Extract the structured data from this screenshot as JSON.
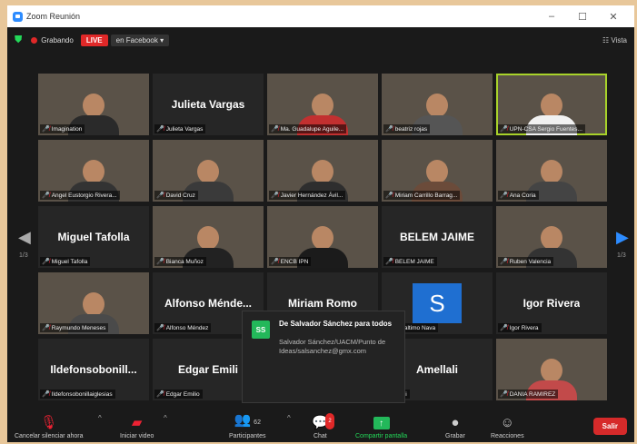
{
  "window": {
    "title": "Zoom Reunión",
    "minimize": "–",
    "maximize": "☐",
    "close": "✕"
  },
  "topbar": {
    "recording": "Grabando",
    "live": "LIVE",
    "stream_target": "en Facebook ▾",
    "view": "☷ Vista"
  },
  "pager": {
    "left_page": "1/3",
    "right_page": "1/3"
  },
  "tiles": [
    {
      "big": "",
      "tag": "Imagination",
      "video": true,
      "shirt": "#2a2a2a"
    },
    {
      "big": "Julieta Vargas",
      "tag": "Julieta Vargas",
      "video": false
    },
    {
      "big": "",
      "tag": "Ma. Guadalupe Aguile...",
      "video": true,
      "shirt": "#c23030"
    },
    {
      "big": "",
      "tag": "beatriz rojas",
      "video": true,
      "shirt": "#555"
    },
    {
      "big": "",
      "tag": "UPN-CSA Sergio Fuentes...",
      "video": true,
      "shirt": "#f1f1f1",
      "active": true
    },
    {
      "big": "",
      "tag": "Angel Eustorgio Rivera...",
      "video": true,
      "shirt": "#333"
    },
    {
      "big": "",
      "tag": "David Cruz",
      "video": true,
      "shirt": "#3a3a3a"
    },
    {
      "big": "",
      "tag": "Javier Hernández Ávil...",
      "video": true,
      "shirt": "#2e2e2e"
    },
    {
      "big": "",
      "tag": "Miriam Carrillo Barrag...",
      "video": true,
      "shirt": "#6b4b3a"
    },
    {
      "big": "",
      "tag": "Ana Coria",
      "video": true,
      "shirt": "#444"
    },
    {
      "big": "Miguel Tafolla",
      "tag": "Miguel Tafolla",
      "video": false
    },
    {
      "big": "",
      "tag": "Bianca Muñoz",
      "video": true,
      "shirt": "#222"
    },
    {
      "big": "",
      "tag": "ENCB IPN",
      "video": true,
      "shirt": "#1b1b1b"
    },
    {
      "big": "BELEM JAIME",
      "tag": "BELEM JAIME",
      "video": false
    },
    {
      "big": "",
      "tag": "Ruben Valencia",
      "video": true,
      "shirt": "#333"
    },
    {
      "big": "",
      "tag": "Raymundo Meneses",
      "video": true,
      "shirt": "#4a4a4a"
    },
    {
      "big": "Alfonso Ménde...",
      "tag": "Alfonso Méndez",
      "video": false
    },
    {
      "big": "Miriam Romo",
      "tag": "",
      "video": false
    },
    {
      "big": "S",
      "tag": "Ir Xaltimo Nava",
      "video": false,
      "sbadge": true
    },
    {
      "big": "Igor Rivera",
      "tag": "Igor Rivera",
      "video": false
    },
    {
      "big": "Ildefonsobonill...",
      "tag": "Ildefonsobonillaiglesias",
      "video": false
    },
    {
      "big": "Edgar Emili",
      "tag": "Edgar Emilio",
      "video": false
    },
    {
      "big": "",
      "tag": "",
      "video": false
    },
    {
      "big": "Amellali",
      "tag": "ellali",
      "video": false
    },
    {
      "big": "",
      "tag": "DANIA RAMIREZ",
      "video": true,
      "shirt": "#c24a4a"
    }
  ],
  "chat_popup": {
    "avatar": "SS",
    "from": "De Salvador Sánchez para todos",
    "message": "Salvador Sánchez/UACM/Punto de Ideas/salsanchez@gmx.com"
  },
  "toolbar": {
    "mute": "Cancelar silenciar ahora",
    "video": "Iniciar video",
    "participants": "Participantes",
    "participants_count": "62",
    "chat": "Chat",
    "chat_badge": "2",
    "share": "Compartir pantalla",
    "record": "Grabar",
    "reactions": "Reacciones",
    "leave": "Salir"
  }
}
